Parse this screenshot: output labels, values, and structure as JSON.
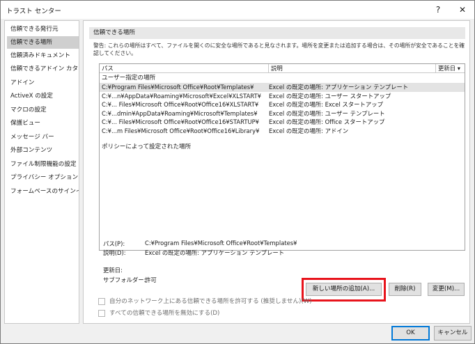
{
  "window": {
    "title": "トラスト センター",
    "help_glyph": "?",
    "close_glyph": "✕"
  },
  "sidebar": {
    "items": [
      {
        "label": "信頼できる発行元"
      },
      {
        "label": "信頼できる場所"
      },
      {
        "label": "信頼済みドキュメント"
      },
      {
        "label": "信頼できるアドイン カタログ"
      },
      {
        "label": "アドイン"
      },
      {
        "label": "ActiveX の設定"
      },
      {
        "label": "マクロの設定"
      },
      {
        "label": "保護ビュー"
      },
      {
        "label": "メッセージ バー"
      },
      {
        "label": "外部コンテンツ"
      },
      {
        "label": "ファイル制限機能の設定"
      },
      {
        "label": "プライバシー オプション"
      },
      {
        "label": "フォームベースのサインイン"
      }
    ],
    "selected_index": 1
  },
  "main": {
    "section_title": "信頼できる場所",
    "warning": "警告: これらの場所はすべて、ファイルを開くのに安全な場所であると見なされます。場所を変更または追加する場合は、その場所が安全であることを確認してください。",
    "table": {
      "headers": {
        "path": "パス",
        "description": "説明",
        "modified": "更新日 ▾"
      },
      "user_group": "ユーザー指定の場所",
      "rows": [
        {
          "path": "C:¥Program Files¥Microsoft Office¥Root¥Templates¥",
          "description": "Excel の既定の場所: アプリケーション テンプレート"
        },
        {
          "path": "C:¥...n¥AppData¥Roaming¥Microsoft¥Excel¥XLSTART¥",
          "description": "Excel の既定の場所: ユーザー スタートアップ"
        },
        {
          "path": "C:¥... Files¥Microsoft Office¥Root¥Office16¥XLSTART¥",
          "description": "Excel の既定の場所: Excel スタートアップ"
        },
        {
          "path": "C:¥...dmin¥AppData¥Roaming¥Microsoft¥Templates¥",
          "description": "Excel の既定の場所: ユーザー テンプレート"
        },
        {
          "path": "C:¥... Files¥Microsoft Office¥Root¥Office16¥STARTUP¥",
          "description": "Excel の既定の場所: Office スタートアップ"
        },
        {
          "path": "C:¥...m Files¥Microsoft Office¥Root¥Office16¥Library¥",
          "description": "Excel の既定の場所: アドイン"
        }
      ],
      "selected_row": 0,
      "policy_group": "ポリシーによって設定された場所"
    },
    "details": {
      "path_label": "パス(P):",
      "path_value": "C:¥Program Files¥Microsoft Office¥Root¥Templates¥",
      "description_label": "説明(D):",
      "description_value": "Excel の既定の場所: アプリケーション テンプレート",
      "modified_label": "更新日:",
      "modified_value": "",
      "subfolders_label": "サブフォルダー:",
      "subfolders_value": "許可"
    },
    "buttons": {
      "add_location": "新しい場所の追加(A)...",
      "remove": "削除(R)",
      "modify": "変更(M)..."
    },
    "checkboxes": {
      "allow_network": "自分のネットワーク上にある信頼できる場所を許可する (推奨しません)(W)",
      "disable_all": "すべての信頼できる場所を無効にする(D)"
    },
    "highlight_color": "#e8141c"
  },
  "footer": {
    "ok": "OK",
    "cancel": "キャンセル"
  }
}
